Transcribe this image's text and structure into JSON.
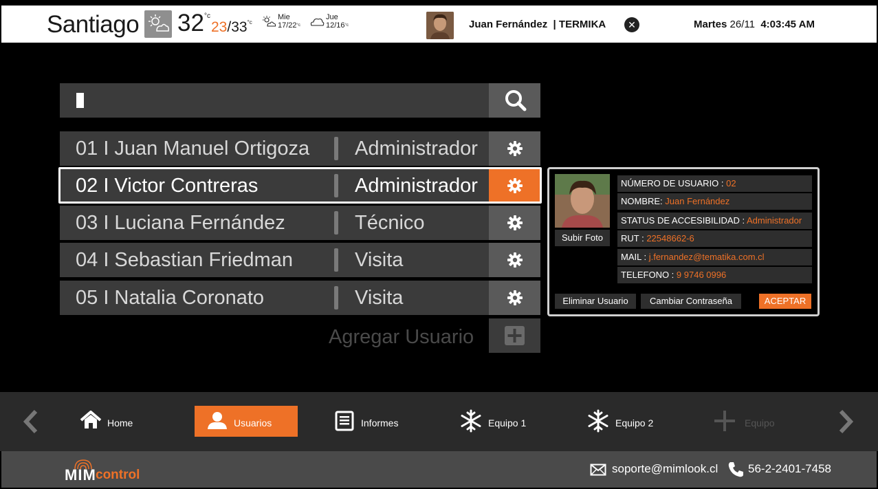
{
  "weather": {
    "city": "Santiago",
    "temp_now": "32",
    "temp_unit": "°c",
    "temp_min": "23",
    "temp_max": "33",
    "temp_range_unit": "°c",
    "icon": "sun-cloud-icon",
    "forecast": [
      {
        "day": "Mie",
        "range": "17/22",
        "unit": "°c",
        "icon": "sun-cloud-icon"
      },
      {
        "day": "Jue",
        "range": "12/16",
        "unit": "°c",
        "icon": "cloud-icon"
      }
    ]
  },
  "header": {
    "user_name": "Juan Fernández",
    "company": "| TERMIKA",
    "day_label": "Martes",
    "date": "26/11",
    "time": "4:03:45 AM"
  },
  "search": {
    "value": ""
  },
  "users": [
    {
      "label": "01  I  Juan Manuel Ortigoza",
      "role": "Administrador"
    },
    {
      "label": "02  I  Victor Contreras",
      "role": "Administrador"
    },
    {
      "label": "03  I  Luciana Fernández",
      "role": "Técnico"
    },
    {
      "label": "04  I  Sebastian Friedman",
      "role": "Visita"
    },
    {
      "label": "05  I  Natalia Coronato",
      "role": "Visita"
    }
  ],
  "add_user_label": "Agregar Usuario",
  "detail": {
    "upload_photo": "Subir Foto",
    "fields": [
      {
        "label": "NÚMERO DE USUARIO : ",
        "value": "02"
      },
      {
        "label": "NOMBRE: ",
        "value": "Juan Fernández"
      },
      {
        "label": "STATUS DE ACCESIBILIDAD : ",
        "value": "Administrador"
      },
      {
        "label": "RUT : ",
        "value": "22548662-6"
      },
      {
        "label": "MAIL : ",
        "value": "j.fernandez@tematika.com.cl"
      },
      {
        "label": "TELEFONO : ",
        "value": "9 9746 0996"
      }
    ],
    "delete_label": "Eliminar Usuario",
    "change_pwd_label": "Cambiar Contraseña",
    "accept_label": "ACEPTAR"
  },
  "nav": {
    "items": [
      {
        "label": "Home",
        "icon": "home-icon"
      },
      {
        "label": "Usuarios",
        "icon": "user-icon"
      },
      {
        "label": "Informes",
        "icon": "document-icon"
      },
      {
        "label": "Equipo 1",
        "icon": "snowflake-icon"
      },
      {
        "label": "Equipo 2",
        "icon": "snowflake-icon"
      },
      {
        "label": "Equipo",
        "icon": "plus-icon"
      }
    ]
  },
  "footer": {
    "logo_mim": "MIM",
    "logo_control": "control",
    "email": "soporte@mimlook.cl",
    "phone": "56-2-2401-7458"
  },
  "colors": {
    "accent": "#ee7127",
    "row_bg": "#3b3b3b",
    "button_bg": "#5a5a5a",
    "nav_bg": "#2a2a2a",
    "footer_bg": "#4a4a4a"
  }
}
